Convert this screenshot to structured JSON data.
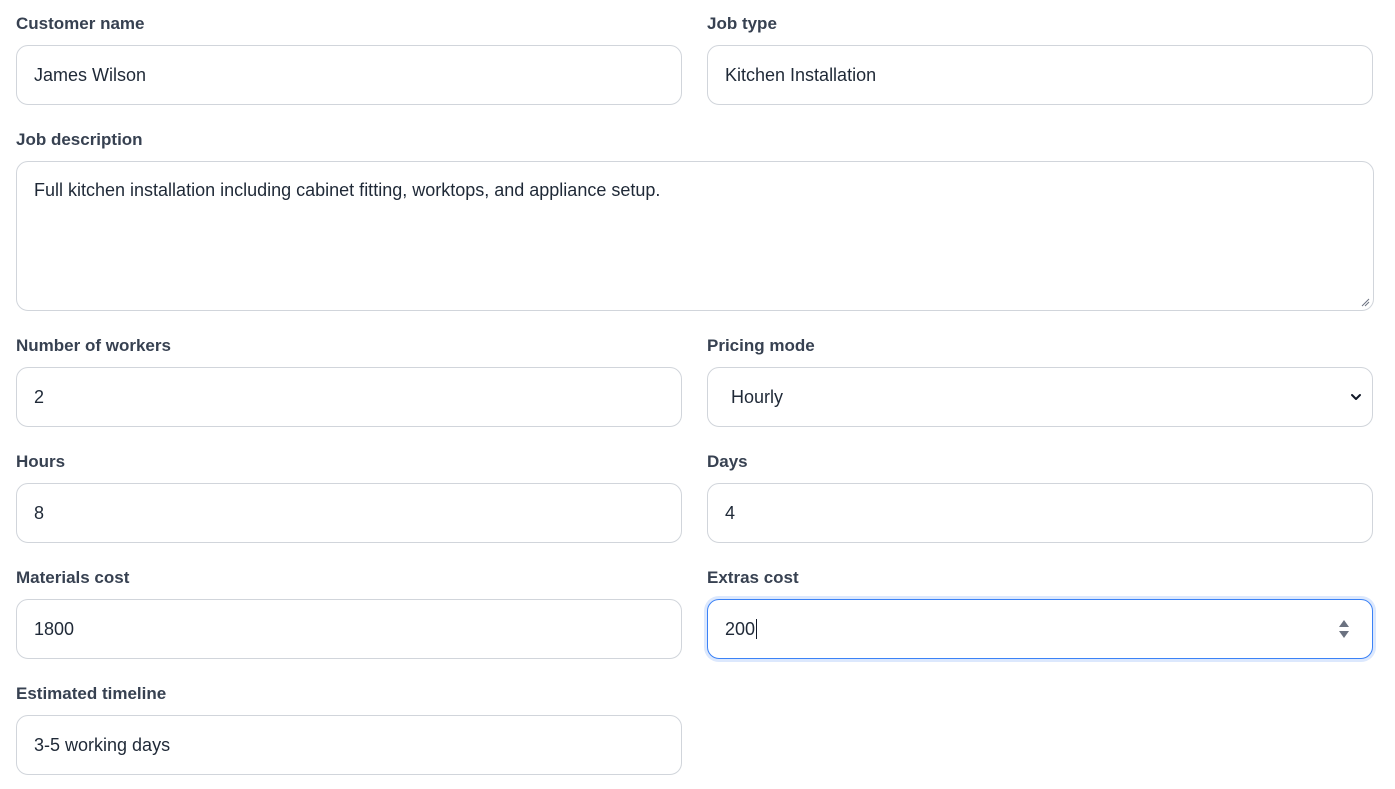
{
  "form": {
    "customer_name": {
      "label": "Customer name",
      "value": "James Wilson"
    },
    "job_type": {
      "label": "Job type",
      "value": "Kitchen Installation"
    },
    "job_description": {
      "label": "Job description",
      "value": "Full kitchen installation including cabinet fitting, worktops, and appliance setup."
    },
    "number_of_workers": {
      "label": "Number of workers",
      "value": "2"
    },
    "pricing_mode": {
      "label": "Pricing mode",
      "selected": "Hourly"
    },
    "hours": {
      "label": "Hours",
      "value": "8"
    },
    "days": {
      "label": "Days",
      "value": "4"
    },
    "materials_cost": {
      "label": "Materials cost",
      "value": "1800"
    },
    "extras_cost": {
      "label": "Extras cost",
      "value": "200"
    },
    "estimated_timeline": {
      "label": "Estimated timeline",
      "value": "3-5 working days"
    }
  },
  "icons": {
    "select_arrow": "chevron-down-icon",
    "number_spinner": "spinner-arrows-icon",
    "resize": "resize-handle-icon"
  },
  "colors": {
    "border": "#d1d5db",
    "focus": "#3b82f6",
    "label": "#374151",
    "text": "#1f2937"
  }
}
